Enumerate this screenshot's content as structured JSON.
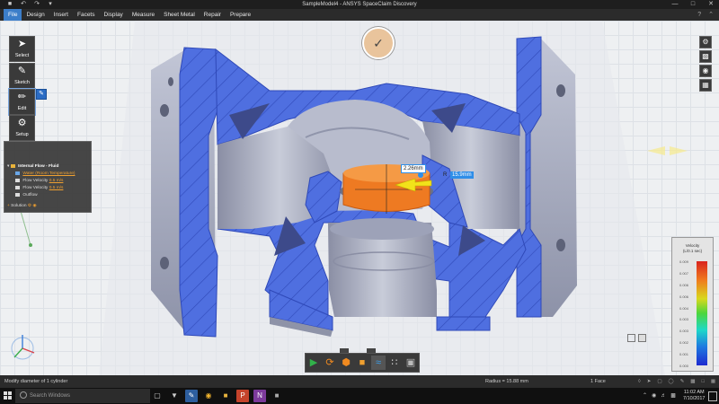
{
  "window": {
    "title": "SampleModel4 - ANSYS SpaceClaim Discovery",
    "quick_access": [
      "save-icon",
      "undo-icon",
      "redo-icon",
      "dropdown-icon"
    ],
    "controls": [
      "minimize-icon",
      "maximize-icon",
      "close-icon"
    ]
  },
  "menu": {
    "items": [
      "File",
      "Design",
      "Insert",
      "Facets",
      "Display",
      "Measure",
      "Sheet Metal",
      "Repair",
      "Prepare"
    ],
    "active": "File",
    "right_icons": [
      "help-icon",
      "minimize-ribbon-icon"
    ]
  },
  "tools": [
    {
      "label": "Select",
      "icon": "arrow-cursor-icon"
    },
    {
      "label": "Sketch",
      "icon": "pencil-icon"
    },
    {
      "label": "Edit",
      "icon": "edit-brush-icon"
    },
    {
      "label": "Setup",
      "icon": "setup-icon"
    }
  ],
  "tree": {
    "root": "Internal Flow - Fluid",
    "material": "Water (Room Temperature)",
    "items": [
      {
        "name": "Flow Velocity",
        "value": "0.5 m/s"
      },
      {
        "name": "Flow Velocity",
        "value": "0.5 m/s"
      },
      {
        "name": "Outflow",
        "value": ""
      }
    ],
    "solution": "Solution"
  },
  "dimensions": {
    "primary": "2.26mm",
    "radius_label": "R",
    "radius_value": "15.9mm"
  },
  "legend": {
    "title": "Velocity",
    "unit": "(L/0.1 sec)",
    "ticks": [
      "0.009",
      "0.007",
      "0.006",
      "0.006",
      "0.004",
      "0.003",
      "0.003",
      "0.002",
      "0.001",
      "0.000"
    ]
  },
  "status": {
    "message": "Modify diameter of 1 cylinder",
    "radius": "Radius = 15.88 mm",
    "faces": "1 Face"
  },
  "taskbar": {
    "search_placeholder": "Search Windows",
    "time": "11:02 AM",
    "date": "7/10/2017"
  },
  "colors": {
    "accent": "#3c7ec9",
    "section_blue": "#4f6fe0",
    "body_gray": "#a7acc0",
    "selected_face": "#ee7a22",
    "dimension": "#2f8ee8"
  }
}
